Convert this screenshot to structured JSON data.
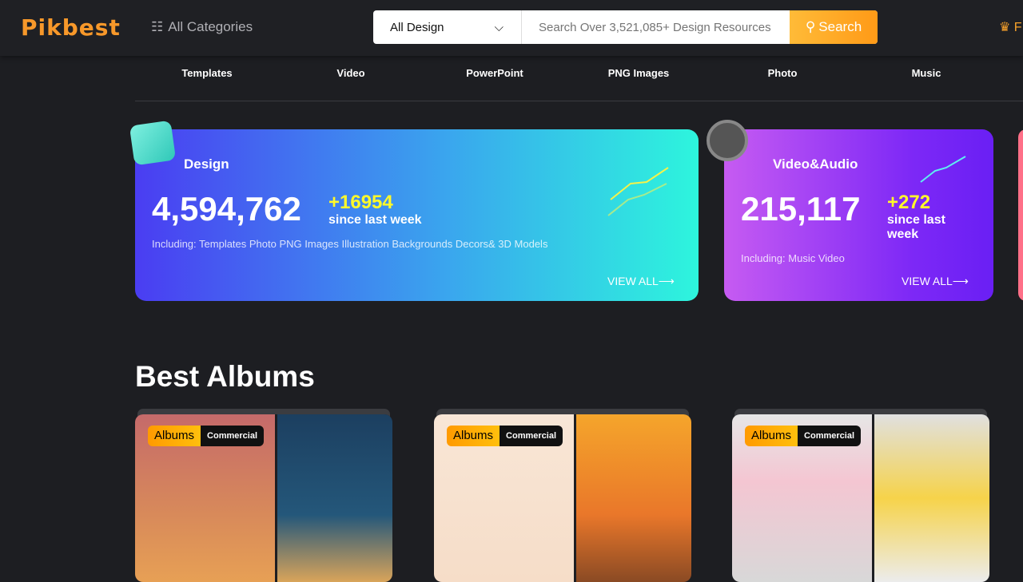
{
  "header": {
    "logo": "Pikbest",
    "all_categories": "All Categories",
    "search_category": "All Design",
    "search_placeholder": "Search Over 3,521,085+ Design Resources",
    "search_button": "Search",
    "premium_partial": "F"
  },
  "categories": [
    "Templates",
    "Video",
    "PowerPoint",
    "PNG Images",
    "Photo",
    "Music"
  ],
  "stats": [
    {
      "title": "Design",
      "count": "4,594,762",
      "delta": "+16954",
      "since": "since last week",
      "including": "Including: Templates Photo PNG Images Illustration Backgrounds Decors& 3D Models",
      "view_all": "VIEW ALL⟶"
    },
    {
      "title": "Video&Audio",
      "count": "215,117",
      "delta": "+272",
      "since": "since last week",
      "including": "Including: Music Video",
      "view_all": "VIEW ALL⟶"
    }
  ],
  "albums_section": {
    "title": "Best Albums",
    "albums": [
      {
        "tag": "Albums",
        "license": "Commercial"
      },
      {
        "tag": "Albums",
        "license": "Commercial"
      },
      {
        "tag": "Albums",
        "license": "Commercial"
      }
    ]
  }
}
